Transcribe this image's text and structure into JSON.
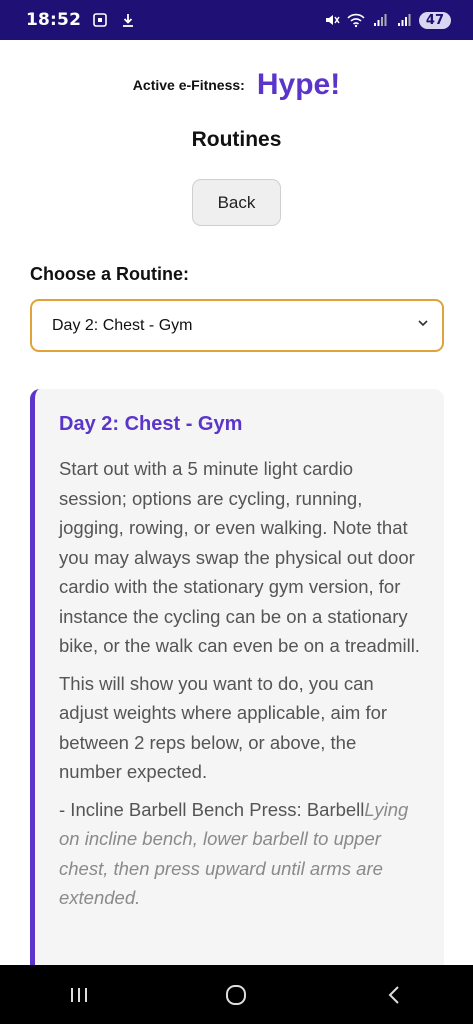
{
  "status_bar": {
    "time": "18:52",
    "battery": "47"
  },
  "header": {
    "brand_small": "Active e-Fitness:",
    "brand_big": "Hype!",
    "title": "Routines"
  },
  "back_button": "Back",
  "routine_select": {
    "label": "Choose a Routine:",
    "selected": "Day 2: Chest - Gym"
  },
  "card": {
    "title": "Day 2: Chest - Gym",
    "paragraph1": "Start out with a 5 minute light cardio session; options are cycling, running, jogging, rowing, or even walking. Note that you may always swap the physical out door cardio with the stationary gym version, for instance the cycling can be on a stationary bike, or the walk can even be on a treadmill.",
    "paragraph2": "This will show you want to do, you can adjust weights where applicable, aim for between 2 reps below, or above, the number expected.",
    "exercise": {
      "prefix": "- Incline Barbell Bench Press: ",
      "equipment": "Barbell",
      "description": "Lying on incline bench, lower barbell to upper chest, then press upward until arms are extended."
    }
  },
  "colors": {
    "status_bar": "#1e1075",
    "accent": "#5b35c9",
    "select_border": "#e0a33a",
    "card_bg": "#f5f5f5"
  },
  "icons": {
    "status_left": [
      "screenshot-icon",
      "download-icon"
    ],
    "status_right": [
      "mute-icon",
      "wifi-icon",
      "signal-icon",
      "signal-icon-2",
      "battery-icon"
    ],
    "nav": [
      "recents-icon",
      "home-icon",
      "back-nav-icon"
    ],
    "select": "chevron-down-icon"
  }
}
